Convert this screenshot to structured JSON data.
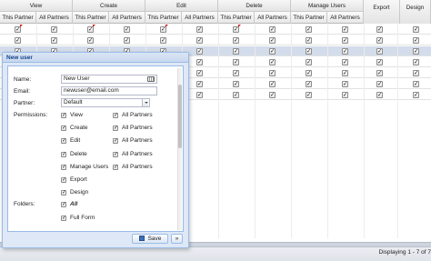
{
  "grid": {
    "header_groups": [
      "View",
      "Create",
      "Edit",
      "Delete",
      "Manage Users",
      "Export",
      "Design"
    ],
    "header_subcols": [
      "This Partner",
      "All Partners"
    ],
    "rows": [
      {
        "dirty": [
          true,
          false,
          true,
          false,
          true,
          false,
          true,
          false,
          false,
          false,
          false,
          false
        ]
      },
      {
        "dirty": [
          false,
          false,
          false,
          false,
          false,
          false,
          false,
          false,
          false,
          false,
          false,
          false
        ]
      },
      {
        "dirty": [
          false,
          false,
          false,
          false,
          false,
          false,
          false,
          false,
          false,
          false,
          false,
          false
        ]
      },
      {
        "dirty": [
          false,
          false,
          false,
          false,
          false,
          false,
          false,
          false,
          false,
          false,
          false,
          false
        ]
      },
      {
        "dirty": [
          false,
          false,
          false,
          false,
          false,
          false,
          false,
          false,
          false,
          false,
          false,
          false
        ]
      },
      {
        "dirty": [
          false,
          false,
          false,
          false,
          false,
          false,
          false,
          false,
          false,
          false,
          false,
          false
        ]
      },
      {
        "dirty": [
          false,
          false,
          false,
          false,
          false,
          false,
          false,
          false,
          false,
          false,
          false,
          false
        ]
      }
    ],
    "checked_mark": "✓",
    "status": "Displaying 1 - 7 of 7"
  },
  "dialog": {
    "title": "New user",
    "name_label": "Name:",
    "name_value": "New User",
    "email_label": "Email:",
    "email_value": "newuser@email.com",
    "partner_label": "Partner:",
    "partner_value": "Default",
    "permissions_label": "Permissions:",
    "permissions": [
      {
        "label": "View",
        "all_label": "All Partners"
      },
      {
        "label": "Create",
        "all_label": "All Partners"
      },
      {
        "label": "Edit",
        "all_label": "All Partners"
      },
      {
        "label": "Delete",
        "all_label": "All Partners"
      },
      {
        "label": "Manage Users",
        "all_label": "All Partners"
      },
      {
        "label": "Export",
        "all_label": ""
      },
      {
        "label": "Design",
        "all_label": ""
      }
    ],
    "folders_label": "Folders:",
    "folders": [
      {
        "label": "All"
      },
      {
        "label": "Full Form"
      }
    ],
    "save_label": "Save",
    "more_label": "»"
  },
  "colors": {
    "dialog_bg": "#dfe8f6",
    "dialog_border": "#99bbe8",
    "title_text": "#15428b",
    "selected_row": "#d3dcea",
    "dirty_marker": "#d42020"
  },
  "icons": {
    "checkbox": "checkmark",
    "save": "floppy-disk-icon",
    "keyboard": "keyboard-icon",
    "dropdown": "chevron-down-icon"
  }
}
